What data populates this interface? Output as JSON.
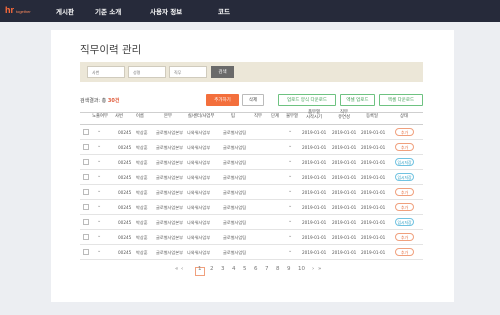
{
  "header": {
    "logo": "hr",
    "logo_sub": "together",
    "nav": [
      "게시판",
      "기준 소개",
      "사용자 정보",
      "코드"
    ]
  },
  "page": {
    "title": "직무이력 관리"
  },
  "search": {
    "placeholders": [
      "사번",
      "성명",
      "직무"
    ],
    "button": "검색"
  },
  "result": {
    "label": "검색결과: 총 ",
    "count": "30건"
  },
  "actions": {
    "add": "추가하기",
    "delete": "삭제",
    "template_download": "업로드 양식 다운로드",
    "excel_upload": "엑셀 업로드",
    "excel_download": "엑셀 다운로드"
  },
  "table": {
    "columns": [
      "노출여부",
      "사번",
      "이름",
      "본부",
      "실/센터/사업부",
      "팀",
      "직무",
      "단계",
      "불무열",
      "품무열\n시작시기",
      "직무\n유연성",
      "등록일",
      "상태"
    ],
    "rows": [
      {
        "id": "00245",
        "name": "박상훈",
        "hq": "글로벌사업본부",
        "div": "나와워사업부",
        "team": "글로벌사업팀",
        "d1": "2019-01-01",
        "d2": "2019-01-01",
        "d3": "2019-01-01",
        "status": "추가",
        "kind": "add"
      },
      {
        "id": "00245",
        "name": "박상훈",
        "hq": "글로벌사업본부",
        "div": "나와워사업부",
        "team": "글로벌사업팀",
        "d1": "2019-01-01",
        "d2": "2019-01-01",
        "d3": "2019-01-01",
        "status": "추가",
        "kind": "add"
      },
      {
        "id": "00245",
        "name": "박상훈",
        "hq": "글로벌사업본부",
        "div": "나와워사업부",
        "team": "글로벌사업팀",
        "d1": "2019-01-01",
        "d2": "2019-01-01",
        "d3": "2019-01-01",
        "status": "임시저장",
        "kind": "mod"
      },
      {
        "id": "00245",
        "name": "박상훈",
        "hq": "글로벌사업본부",
        "div": "나와워사업부",
        "team": "글로벌사업팀",
        "d1": "2019-01-01",
        "d2": "2019-01-01",
        "d3": "2019-01-01",
        "status": "임시저장",
        "kind": "mod"
      },
      {
        "id": "00245",
        "name": "박상훈",
        "hq": "글로벌사업본부",
        "div": "나와워사업부",
        "team": "글로벌사업팀",
        "d1": "2019-01-01",
        "d2": "2019-01-01",
        "d3": "2019-01-01",
        "status": "추가",
        "kind": "add"
      },
      {
        "id": "00245",
        "name": "박상훈",
        "hq": "글로벌사업본부",
        "div": "나와워사업부",
        "team": "글로벌사업팀",
        "d1": "2019-01-01",
        "d2": "2019-01-01",
        "d3": "2019-01-01",
        "status": "추가",
        "kind": "add"
      },
      {
        "id": "00245",
        "name": "박상훈",
        "hq": "글로벌사업본부",
        "div": "나와워사업부",
        "team": "글로벌사업팀",
        "d1": "2019-01-01",
        "d2": "2019-01-01",
        "d3": "2019-01-01",
        "status": "임시저장",
        "kind": "mod"
      },
      {
        "id": "00245",
        "name": "박상훈",
        "hq": "글로벌사업본부",
        "div": "나와워사업부",
        "team": "글로벌사업팀",
        "d1": "2019-01-01",
        "d2": "2019-01-01",
        "d3": "2019-01-01",
        "status": "추가",
        "kind": "add"
      },
      {
        "id": "00245",
        "name": "박상훈",
        "hq": "글로벌사업본부",
        "div": "나와워사업부",
        "team": "글로벌사업팀",
        "d1": "2019-01-01",
        "d2": "2019-01-01",
        "d3": "2019-01-01",
        "status": "추가",
        "kind": "add"
      }
    ]
  },
  "pagination": {
    "first": "«",
    "prev": "‹",
    "pages": [
      "1",
      "2",
      "3",
      "4",
      "5",
      "6",
      "7",
      "8",
      "9",
      "10"
    ],
    "current": "1",
    "next": "›",
    "last": "»"
  },
  "colors": {
    "topbar": "#262a3a",
    "accent": "#f36f3c",
    "green": "#3d9c52",
    "blue": "#2a9cc2"
  }
}
